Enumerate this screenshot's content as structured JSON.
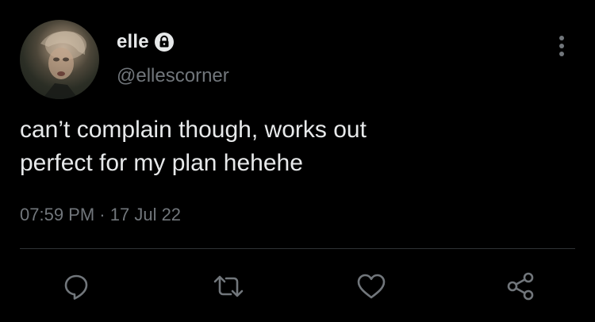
{
  "author": {
    "display_name": "elle",
    "handle": "@ellescorner",
    "protected_icon": "lock-icon",
    "avatar": "profile-photo"
  },
  "tweet": {
    "text": "can’t complain though, works out\nperfect for my plan hehehe",
    "time": "07:59 PM",
    "separator": "·",
    "date": "17 Jul 22"
  },
  "actions": {
    "reply_icon": "reply-icon",
    "retweet_icon": "retweet-icon",
    "like_icon": "heart-icon",
    "share_icon": "share-icon"
  },
  "colors": {
    "background": "#000000",
    "primary_text": "#e7e9ea",
    "secondary_text": "#71767b",
    "divider": "#2f3336"
  }
}
